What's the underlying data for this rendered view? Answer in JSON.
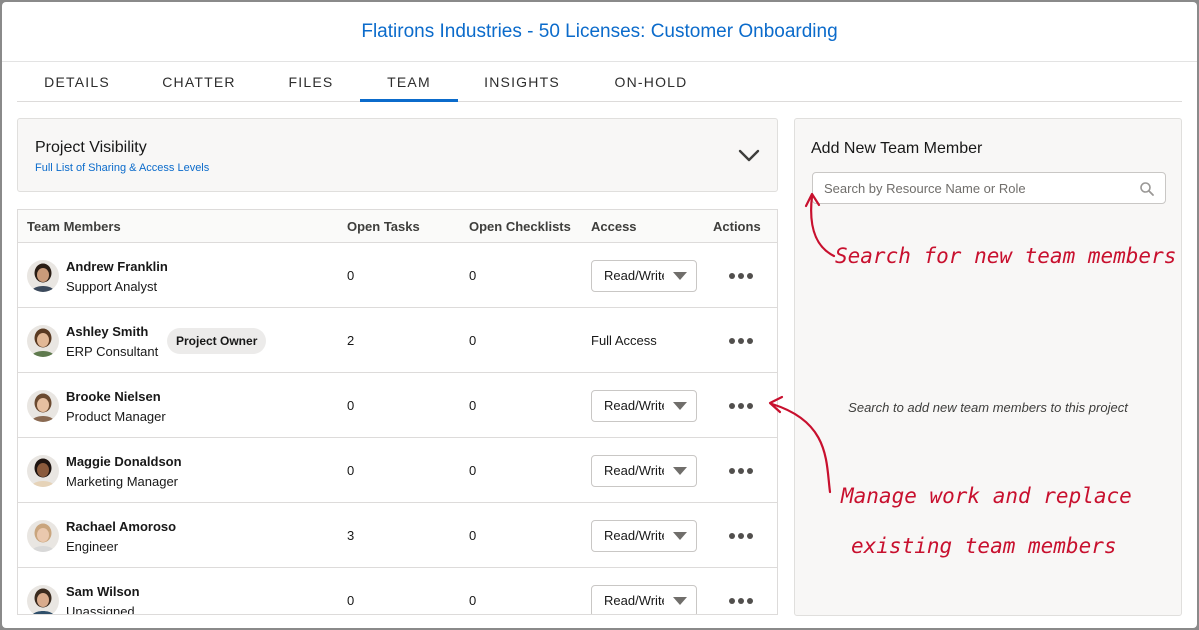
{
  "modal": {
    "title": "Flatirons Industries - 50 Licenses: Customer Onboarding"
  },
  "tabs": [
    {
      "label": "DETAILS",
      "active": false
    },
    {
      "label": "CHATTER",
      "active": false
    },
    {
      "label": "FILES",
      "active": false
    },
    {
      "label": "TEAM",
      "active": true
    },
    {
      "label": "INSIGHTS",
      "active": false
    },
    {
      "label": "ON-HOLD",
      "active": false
    }
  ],
  "visibility": {
    "title": "Project Visibility",
    "link": "Full List of Sharing & Access Levels",
    "icon": "chevron-down-icon"
  },
  "team_table": {
    "headers": {
      "members": "Team Members",
      "open_tasks": "Open Tasks",
      "open_checklists": "Open Checklists",
      "access": "Access",
      "actions": "Actions"
    },
    "rows": [
      {
        "name": "Andrew Franklin",
        "role": "Support Analyst",
        "open_tasks": "0",
        "open_checklists": "0",
        "access": "Read/Write",
        "badge": "",
        "skin": "#c99a7a",
        "hair": "#2a1d15",
        "shirt": "#3c4a5c"
      },
      {
        "name": "Ashley Smith",
        "role": "ERP Consultant",
        "open_tasks": "2",
        "open_checklists": "0",
        "access": "Full Access",
        "badge": "Project Owner",
        "skin": "#e2b896",
        "hair": "#5a3a22",
        "shirt": "#5f7a4e"
      },
      {
        "name": "Brooke Nielsen",
        "role": "Product Manager",
        "open_tasks": "0",
        "open_checklists": "0",
        "access": "Read/Write",
        "badge": "",
        "skin": "#e6bfa0",
        "hair": "#6b4a30",
        "shirt": "#8a6a52"
      },
      {
        "name": "Maggie Donaldson",
        "role": "Marketing Manager",
        "open_tasks": "0",
        "open_checklists": "0",
        "access": "Read/Write",
        "badge": "",
        "skin": "#8a5a3c",
        "hair": "#1e1410",
        "shirt": "#e6d3b8"
      },
      {
        "name": "Rachael Amoroso",
        "role": "Engineer",
        "open_tasks": "3",
        "open_checklists": "0",
        "access": "Read/Write",
        "badge": "",
        "skin": "#eac8ae",
        "hair": "#c9a57e",
        "shirt": "#d8d8d8"
      },
      {
        "name": "Sam Wilson",
        "role": "Unassigned",
        "open_tasks": "0",
        "open_checklists": "0",
        "access": "Read/Write",
        "badge": "",
        "skin": "#d9ab8c",
        "hair": "#3a2a1e",
        "shirt": "#2f4f6a"
      }
    ]
  },
  "add_member": {
    "title": "Add New Team Member",
    "search_placeholder": "Search by Resource Name or Role",
    "search_icon": "search-icon",
    "empty_message": "Search to add new team members to this project"
  },
  "annotations": {
    "search_note": "Search for new team members",
    "manage_line1": "Manage work and replace",
    "manage_line2": "existing team members",
    "color": "#c8102e"
  },
  "colors": {
    "brand_blue": "#0b6bcb",
    "panel_bg": "#f8f7f6",
    "border": "#dddbda"
  }
}
